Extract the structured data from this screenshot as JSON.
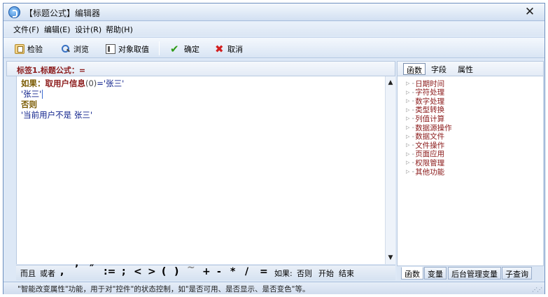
{
  "window": {
    "title": "【标题公式】编辑器",
    "close_glyph": "✕"
  },
  "menu": [
    {
      "label": "文件(F)"
    },
    {
      "label": "编辑(E)"
    },
    {
      "label": "设计(R)"
    },
    {
      "label": "帮助(H)"
    }
  ],
  "toolbar": {
    "check_label": "检验",
    "browse_label": "浏览",
    "object_value_label": "对象取值",
    "confirm_label": "确定",
    "cancel_label": "取消"
  },
  "formula_label": "标签1.标题公式：=",
  "editor": {
    "line1": {
      "kw": "如果：",
      "fn": "取用户信息",
      "arg": "(0)",
      "rest": "='张三'"
    },
    "line2": "'张三'",
    "line3": "否则",
    "line4": "'当前用户不是 张三'"
  },
  "scroll": {
    "up": "▲",
    "down": "▼"
  },
  "operators": [
    "而且",
    "或者",
    ",",
    "’",
    "″",
    ":=",
    ";",
    "<",
    ">",
    "(",
    ")",
    "~",
    "+",
    "-",
    "*",
    "/",
    "=",
    "如果:",
    "否则",
    "开始",
    "结束"
  ],
  "right_tabs": [
    "函数",
    "字段",
    "属性"
  ],
  "tree": {
    "arrow": "▷",
    "dash": "-",
    "items": [
      "日期时间",
      "字符处理",
      "数字处理",
      "类型转换",
      "列值计算",
      "数据源操作",
      "数据文件",
      "文件操作",
      "页面应用",
      "权限管理",
      "其他功能"
    ]
  },
  "bottom_tabs": [
    "函数",
    "变量",
    "后台管理变量",
    "子查询"
  ],
  "status": "\"智能改变属性\"功能，用于对\"控件\"的状态控制，如\"是否可用、是否显示、是否变色\"等。",
  "grip": "⋰⋰"
}
